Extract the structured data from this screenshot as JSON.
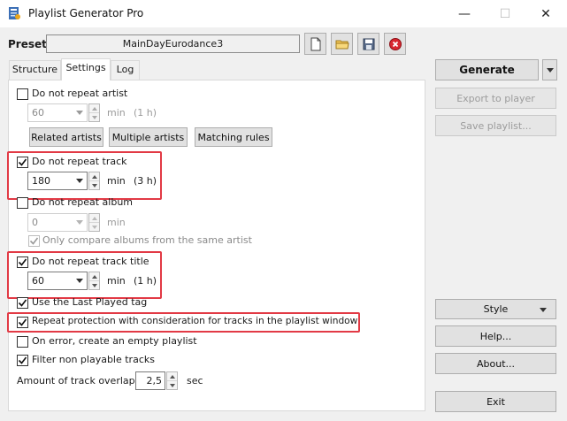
{
  "window": {
    "title": "Playlist Generator Pro",
    "minimize_glyph": "—",
    "maximize_glyph": "☐",
    "close_glyph": "✕"
  },
  "preset": {
    "label": "Preset",
    "value": "MainDayEurodance3"
  },
  "toolbar_icons": [
    "new-file-icon",
    "open-folder-icon",
    "save-disk-icon",
    "delete-icon"
  ],
  "tabs": [
    {
      "label": "Structure",
      "active": false
    },
    {
      "label": "Settings",
      "active": true
    },
    {
      "label": "Log",
      "active": false
    }
  ],
  "settings": {
    "repeat_artist": {
      "label": "Do not repeat artist",
      "checked": false,
      "value": "60",
      "unit": "min",
      "hint": "(1 h)"
    },
    "artist_buttons": {
      "related": "Related artists",
      "multiple": "Multiple artists",
      "matching": "Matching rules"
    },
    "repeat_track": {
      "label": "Do not repeat track",
      "checked": true,
      "value": "180",
      "unit": "min",
      "hint": "(3 h)"
    },
    "repeat_album": {
      "label": "Do not repeat album",
      "checked": false,
      "value": "0",
      "unit": "min",
      "sub_label": "Only compare albums from the same artist",
      "sub_checked": true
    },
    "repeat_title": {
      "label": "Do not repeat track title",
      "checked": true,
      "value": "60",
      "unit": "min",
      "hint": "(1 h)"
    },
    "last_played": {
      "label": "Use the Last Played tag",
      "checked": true
    },
    "playlist_window": {
      "label": "Repeat protection with consideration for tracks in the playlist window",
      "checked": true
    },
    "empty_on_error": {
      "label": "On error, create an empty playlist",
      "checked": false
    },
    "filter_non_playable": {
      "label": "Filter non playable tracks",
      "checked": true
    },
    "overlap": {
      "label": "Amount of track overlap",
      "value": "2,5",
      "unit": "sec"
    }
  },
  "actions": {
    "generate": "Generate",
    "export": "Export to player",
    "save": "Save playlist...",
    "style": "Style",
    "help": "Help...",
    "about": "About...",
    "exit": "Exit"
  },
  "colors": {
    "highlight": "#e23a45",
    "accent": "#0078d7"
  }
}
